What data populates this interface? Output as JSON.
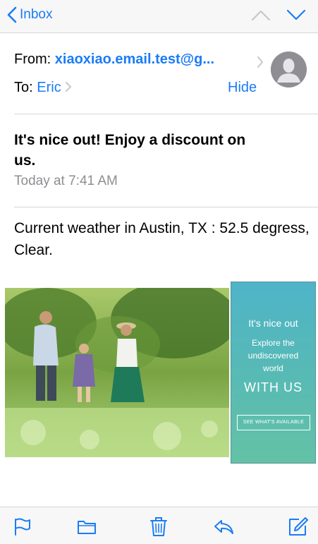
{
  "navbar": {
    "back_label": "Inbox"
  },
  "header": {
    "from_label": "From:",
    "from_value": "xiaoxiao.email.test@g...",
    "to_label": "To:",
    "to_value": "Eric",
    "hide_label": "Hide"
  },
  "message": {
    "subject": "It's nice out! Enjoy a discount on us.",
    "date": "Today at 7:41 AM",
    "body": "Current weather in Austin, TX : 52.5 degress, Clear."
  },
  "ad": {
    "line1": "It's nice out",
    "line2": "Explore the undiscovered world",
    "line3": "WITH US",
    "button": "SEE WHAT'S AVAILABLE"
  },
  "colors": {
    "accent": "#1a7cf5",
    "secondary_text": "#8e8e93"
  },
  "icons": [
    "chevron-left-icon",
    "chevron-up-icon",
    "chevron-down-icon",
    "avatar-icon",
    "flag-icon",
    "folder-icon",
    "trash-icon",
    "reply-icon",
    "compose-icon"
  ]
}
